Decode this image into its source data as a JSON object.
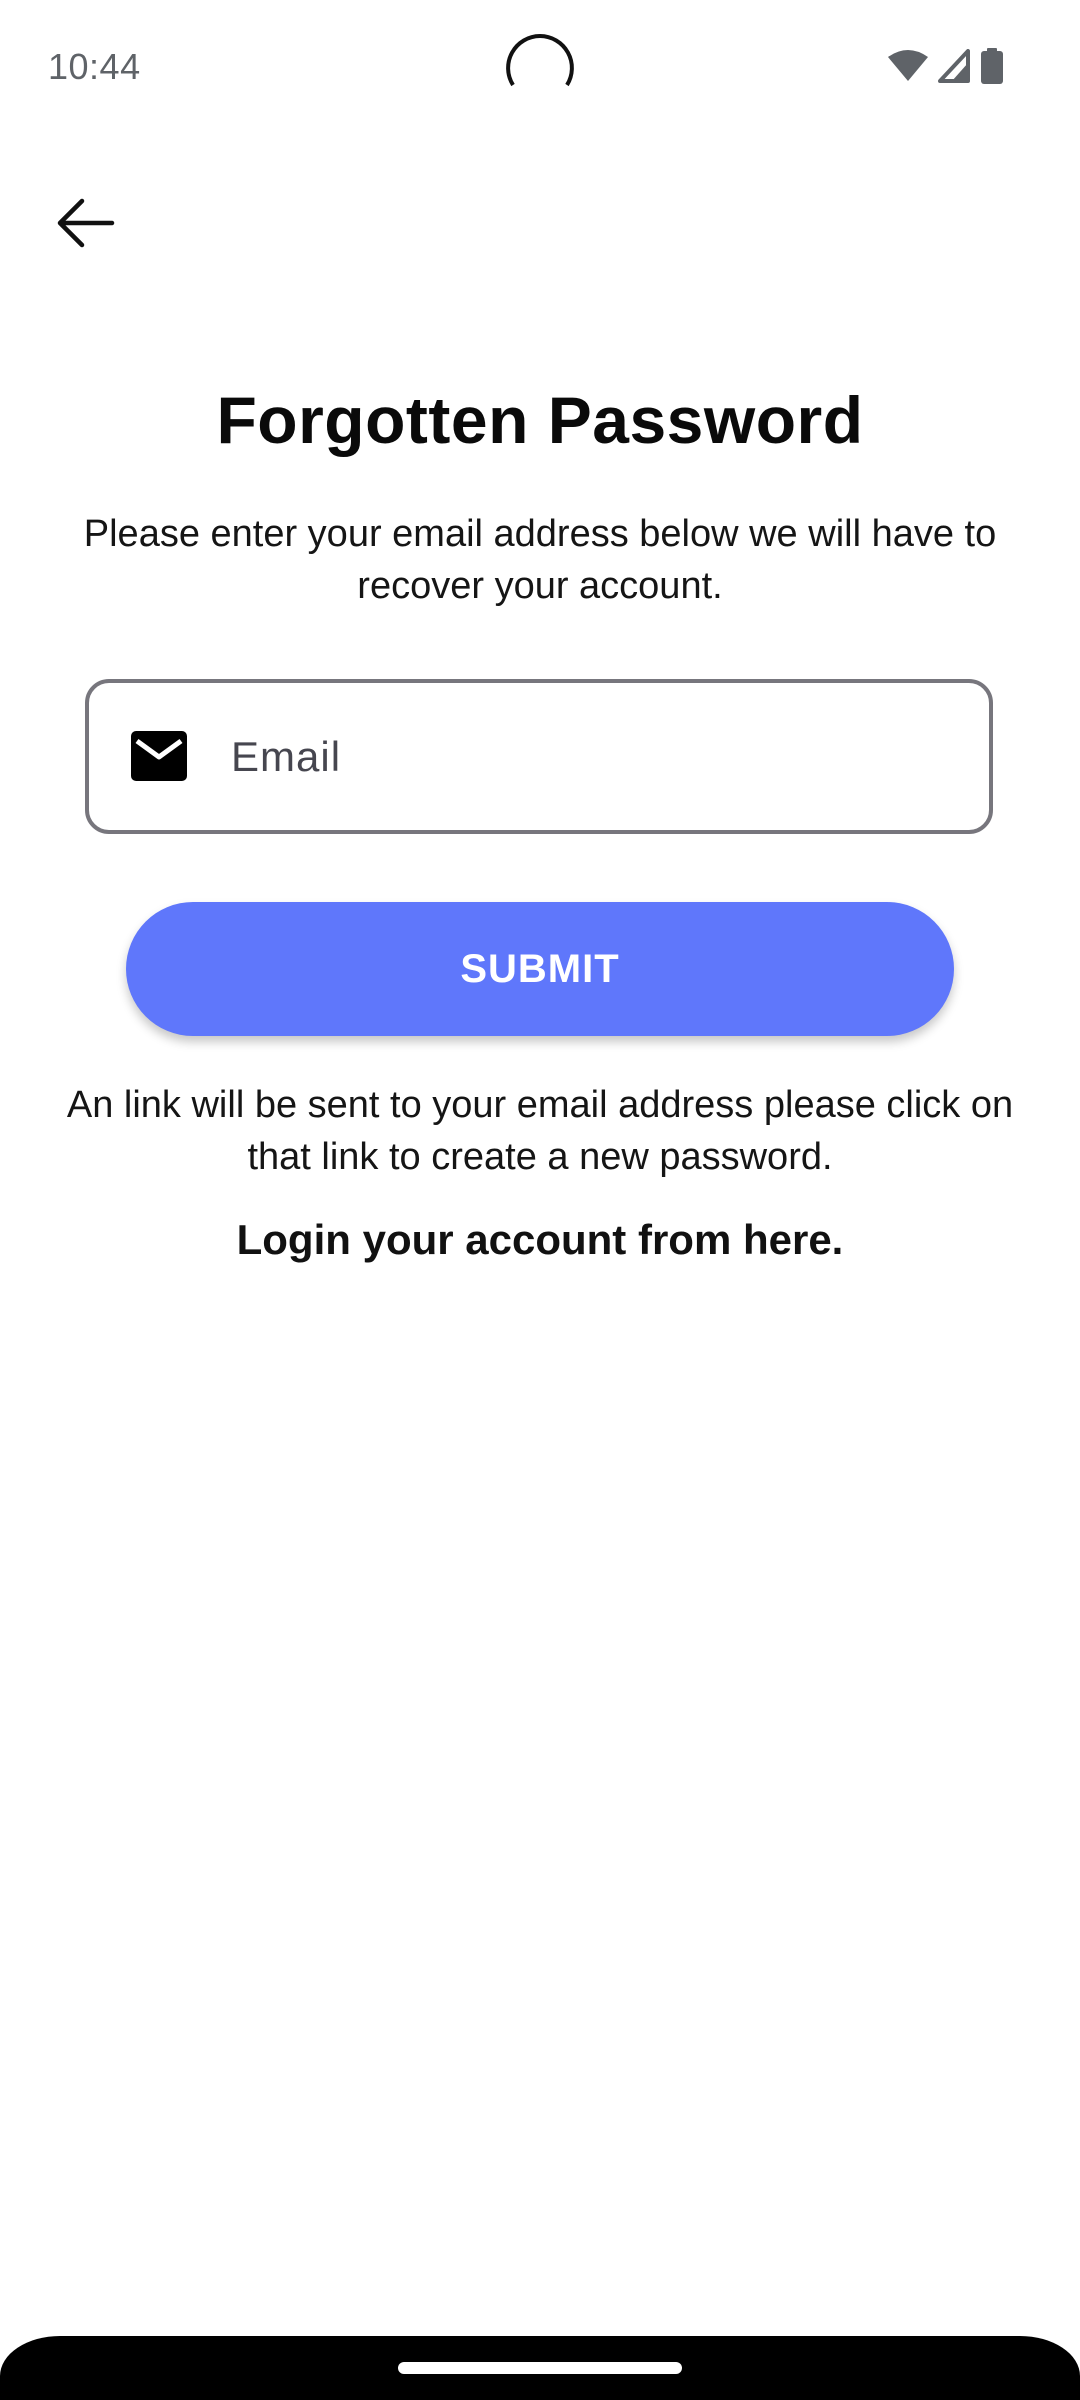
{
  "status_bar": {
    "time": "10:44",
    "icons": [
      "wifi-icon",
      "cellular-signal-icon",
      "battery-icon"
    ]
  },
  "header": {
    "back_icon": "arrow-left-icon"
  },
  "page": {
    "title": "Forgotten Password",
    "subtitle": "Please enter your email address below we will have to recover your account."
  },
  "email_field": {
    "icon": "mail-icon",
    "placeholder": "Email",
    "value": ""
  },
  "submit": {
    "label": "SUBMIT"
  },
  "info": {
    "text": "An link will be sent to your email address please click on that link to create a new password."
  },
  "login_link": {
    "label": "Login your account from here."
  },
  "colors": {
    "accent": "#5f77fb",
    "field_border": "#77767d",
    "text": "#111111"
  }
}
